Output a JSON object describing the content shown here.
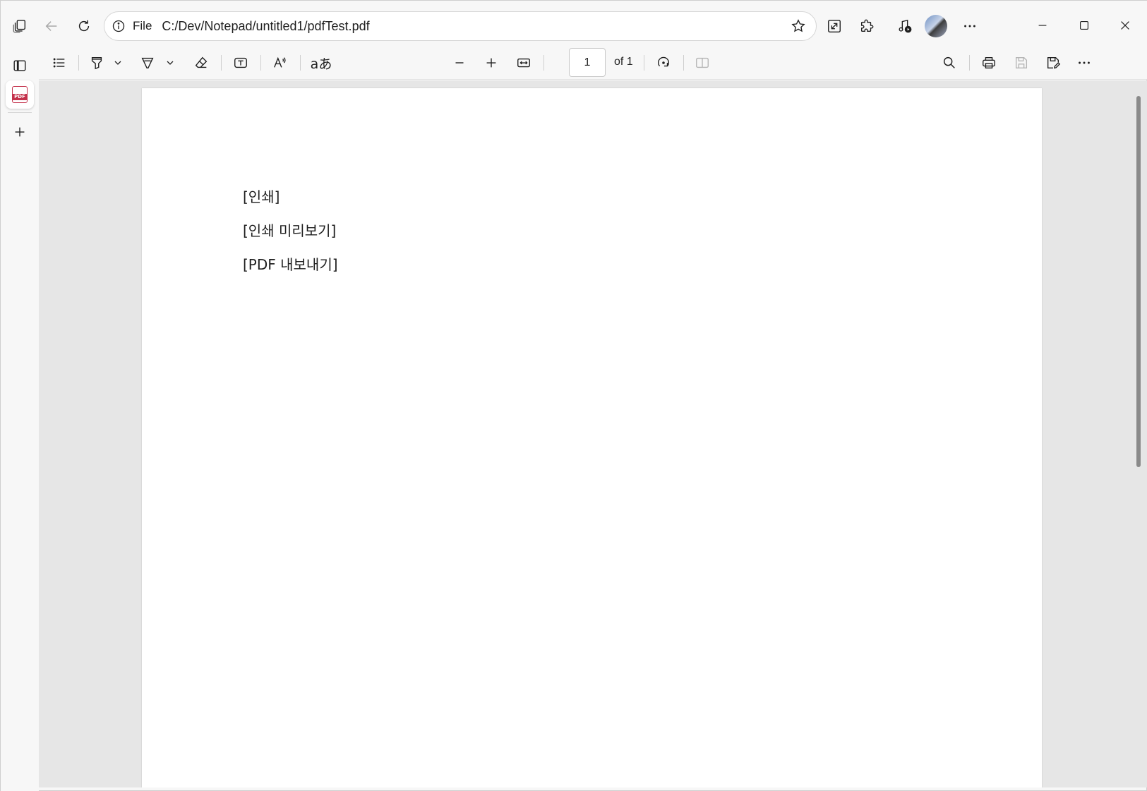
{
  "address_bar": {
    "scheme_label": "File",
    "url": "C:/Dev/Notepad/untitled1/pdfTest.pdf"
  },
  "toolbar": {
    "page_number": "1",
    "page_total": "of 1",
    "translate_label": "aあ"
  },
  "document": {
    "lines": [
      "[인쇄]",
      "[인쇄 미리보기]",
      "[PDF 내보내기]"
    ]
  },
  "icons": {
    "workspaces": "workspaces-icon",
    "back": "back-arrow-icon",
    "refresh": "refresh-icon",
    "info": "info-icon",
    "favorite": "star-icon",
    "immersive": "expand-icon",
    "extensions": "puzzle-icon",
    "media": "media-control-icon",
    "more": "ellipsis-icon",
    "pdf_tab": "pdf-file-icon",
    "new_tab": "plus-icon"
  },
  "colors": {
    "chrome_bg": "#f7f7f7",
    "viewer_bg": "#e6e6e6",
    "pdf_accent": "#c4314b"
  }
}
